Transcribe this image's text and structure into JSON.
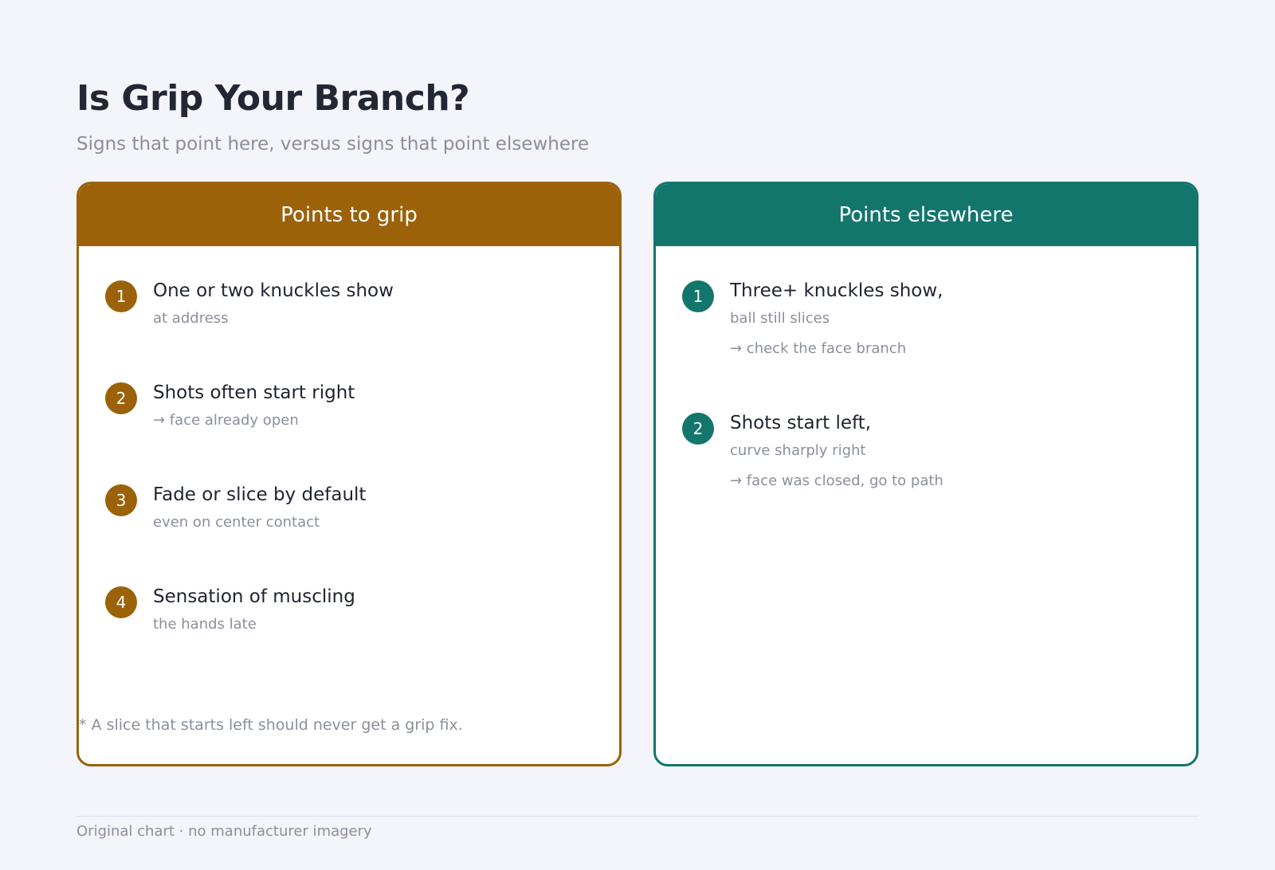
{
  "title": "Is Grip Your Branch?",
  "subtitle": "Signs that point here, versus signs that point elsewhere",
  "colors": {
    "grip_accent": "#9b6209",
    "elsewhere_accent": "#12766d",
    "background": "#f3f5fb"
  },
  "grip_panel": {
    "header": "Points to grip",
    "items": [
      {
        "number": "1",
        "title": "One or two knuckles show",
        "lines": [
          "at address"
        ]
      },
      {
        "number": "2",
        "title": "Shots often start right",
        "lines": [
          "→ face already open"
        ]
      },
      {
        "number": "3",
        "title": "Fade or slice by default",
        "lines": [
          "even on center contact"
        ]
      },
      {
        "number": "4",
        "title": "Sensation of muscling",
        "lines": [
          "the hands late"
        ]
      }
    ],
    "footnote": "* A slice that starts left should never get a grip fix."
  },
  "elsewhere_panel": {
    "header": "Points elsewhere",
    "items": [
      {
        "number": "1",
        "title": "Three+ knuckles show,",
        "lines": [
          "ball still slices",
          "→ check the face branch"
        ]
      },
      {
        "number": "2",
        "title": "Shots start left,",
        "lines": [
          "curve sharply right",
          "→ face was closed, go to path"
        ]
      }
    ]
  },
  "footer": "Original chart · no manufacturer imagery"
}
